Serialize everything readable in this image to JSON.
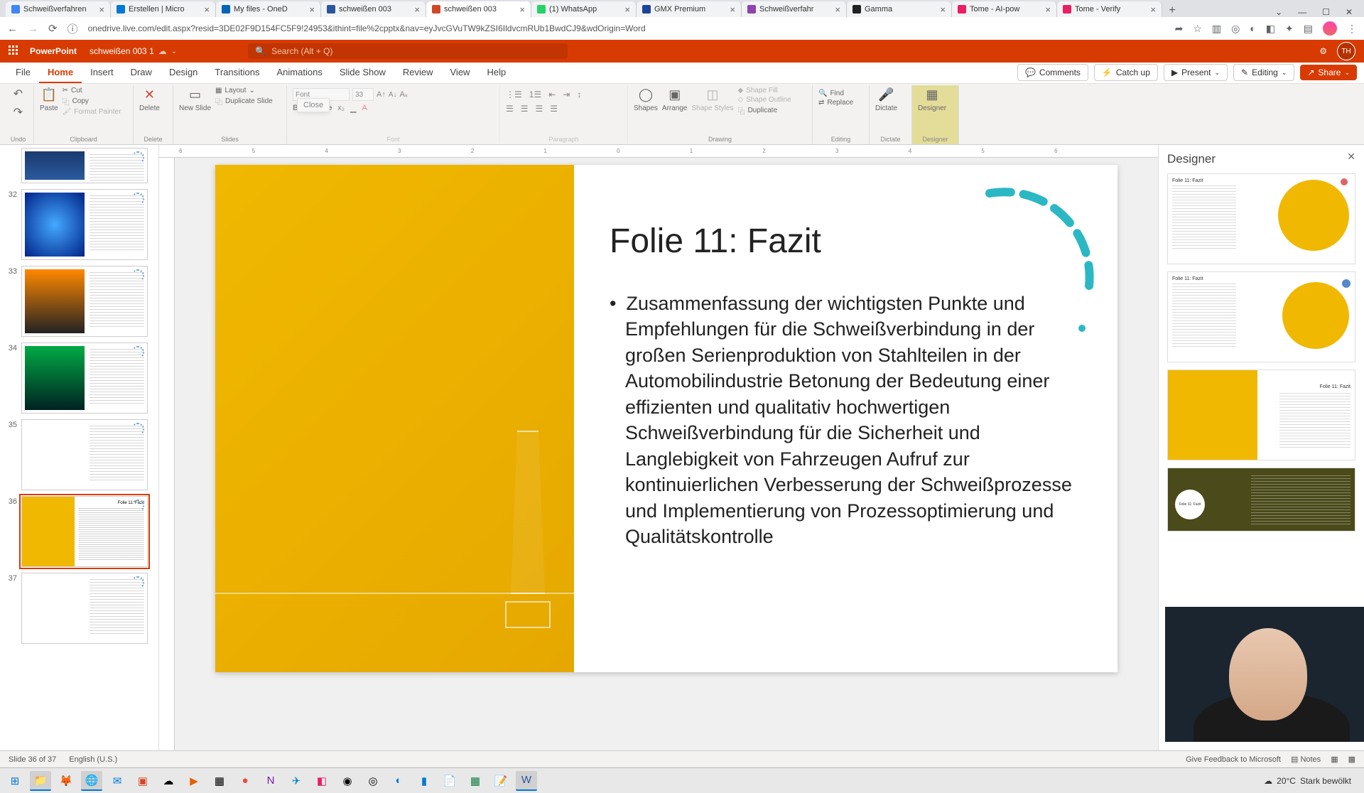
{
  "browser": {
    "tabs": [
      {
        "title": "Schweißverfahren",
        "fav": "#4285f4"
      },
      {
        "title": "Erstellen | Micro",
        "fav": "#0078d4"
      },
      {
        "title": "My files - OneD",
        "fav": "#0364b8"
      },
      {
        "title": "schweißen 003",
        "fav": "#2b579a"
      },
      {
        "title": "schweißen 003",
        "fav": "#d24726",
        "active": true
      },
      {
        "title": "(1) WhatsApp",
        "fav": "#25d366"
      },
      {
        "title": "GMX Premium",
        "fav": "#1c449b"
      },
      {
        "title": "Schweißverfahr",
        "fav": "#8e44ad"
      },
      {
        "title": "Gamma",
        "fav": "#222"
      },
      {
        "title": "Tome - AI-pow",
        "fav": "#e91e63"
      },
      {
        "title": "Tome - Verify",
        "fav": "#e91e63"
      }
    ],
    "url": "onedrive.live.com/edit.aspx?resid=3DE02F9D154FC5F9!24953&ithint=file%2cpptx&nav=eyJvcGVuTW9kZSI6IldvcmRUb1BwdCJ9&wdOrigin=Word"
  },
  "app": {
    "brand": "PowerPoint",
    "doc": "schweißen 003 1",
    "search_placeholder": "Search (Alt + Q)",
    "user_initials": "TH"
  },
  "menu": {
    "items": [
      "File",
      "Home",
      "Insert",
      "Draw",
      "Design",
      "Transitions",
      "Animations",
      "Slide Show",
      "Review",
      "View",
      "Help"
    ],
    "active": 1,
    "comments": "Comments",
    "catchup": "Catch up",
    "present": "Present",
    "editing": "Editing",
    "share": "Share"
  },
  "ribbon": {
    "undo": "Undo",
    "paste": "Paste",
    "cut": "Cut",
    "copy": "Copy",
    "format_painter": "Format Painter",
    "clipboard": "Clipboard",
    "delete": "Delete",
    "new_slide": "New Slide",
    "layout": "Layout",
    "duplicate_slide": "Duplicate Slide",
    "slides": "Slides",
    "close_tip": "Close",
    "font_size": "33",
    "font": "Font",
    "paragraph": "Paragraph",
    "shapes": "Shapes",
    "arrange": "Arrange",
    "shape_styles": "Shape Styles",
    "shape_fill": "Shape Fill",
    "shape_outline": "Shape Outline",
    "duplicate": "Duplicate",
    "drawing": "Drawing",
    "find": "Find",
    "replace": "Replace",
    "editing_grp": "Editing",
    "dictate": "Dictate",
    "designer": "Designer"
  },
  "thumbs": [
    {
      "n": "",
      "partial": true
    },
    {
      "n": "32"
    },
    {
      "n": "33"
    },
    {
      "n": "34"
    },
    {
      "n": "35"
    },
    {
      "n": "36",
      "selected": true
    },
    {
      "n": "37"
    }
  ],
  "slide": {
    "title": "Folie 11: Fazit",
    "body": "Zusammenfassung der wichtigsten Punkte und Empfehlungen für die Schweißverbindung in der großen Serienproduktion von Stahlteilen in der Automobilindustrie Betonung der Bedeutung einer effizienten und qualitativ hochwertigen Schweißverbindung für die Sicherheit und Langlebigkeit von Fahrzeugen Aufruf zur kontinuierlichen Verbesserung der Schweißprozesse und Implementierung von Prozessoptimierung und Qualitätskontrolle"
  },
  "designer": {
    "title": "Designer"
  },
  "status": {
    "slide_of": "Slide 36 of 37",
    "lang": "English (U.S.)",
    "feedback": "Give Feedback to Microsoft",
    "notes": "Notes"
  },
  "taskbar": {
    "temp": "20°C",
    "weather": "Stark bewölkt"
  }
}
